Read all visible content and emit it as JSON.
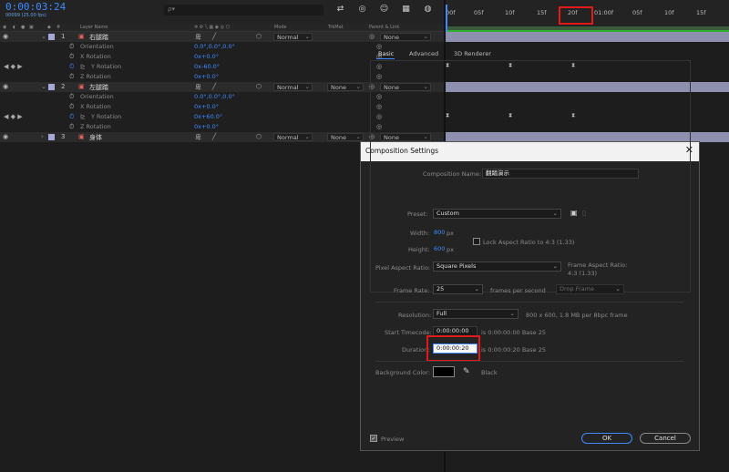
{
  "timeline": {
    "timecode": "0:00:03:24",
    "fps": "00099 (25.00 fps)",
    "search_placeholder": "ρ▾",
    "columns": {
      "layer_name": "Layer Name",
      "mode": "Mode",
      "trkmat": "TrkMat",
      "parent": "Parent & Link"
    },
    "ruler_ticks": [
      "00f",
      "05f",
      "10f",
      "15f",
      "20f",
      "01:00f",
      "05f",
      "10f",
      "15f"
    ],
    "layers": [
      {
        "num": "1",
        "name": "右腿踏",
        "mode": "Normal",
        "trkmat": "",
        "parent": "None",
        "props": [
          {
            "name": "Orientation",
            "value": "0.0°,0.0°,0.0°"
          },
          {
            "name": "X Rotation",
            "value": "0x+0.0°"
          },
          {
            "name": "Y Rotation",
            "value": "0x-60.0°"
          },
          {
            "name": "Z Rotation",
            "value": "0x+0.0°"
          }
        ]
      },
      {
        "num": "2",
        "name": "左腿踏",
        "mode": "Normal",
        "trkmat": "None",
        "parent": "None",
        "props": [
          {
            "name": "Orientation",
            "value": "0.0°,0.0°,0.0°"
          },
          {
            "name": "X Rotation",
            "value": "0x+0.0°"
          },
          {
            "name": "Y Rotation",
            "value": "0x+60.0°"
          },
          {
            "name": "Z Rotation",
            "value": "0x+0.0°"
          }
        ]
      },
      {
        "num": "3",
        "name": "身体",
        "mode": "Normal",
        "trkmat": "None",
        "parent": "None",
        "props": []
      }
    ]
  },
  "dialog": {
    "title": "Composition Settings",
    "close": "✕",
    "comp_name_label": "Composition Name:",
    "comp_name_value": "翻踏演示",
    "tabs": [
      "Basic",
      "Advanced",
      "3D Renderer"
    ],
    "preset_label": "Preset:",
    "preset_value": "Custom",
    "width_label": "Width:",
    "width_value": "800",
    "width_unit": "px",
    "height_label": "Height:",
    "height_value": "600",
    "height_unit": "px",
    "lock_label": "Lock Aspect Ratio to 4:3 (1.33)",
    "par_label": "Pixel Aspect Ratio:",
    "par_value": "Square Pixels",
    "frame_aspect_label": "Frame Aspect Ratio:",
    "frame_aspect_value": "4:3 (1.33)",
    "frame_rate_label": "Frame Rate:",
    "frame_rate_value": "25",
    "fps_text": "frames per second",
    "drop_frame": "Drop Frame",
    "resolution_label": "Resolution:",
    "resolution_value": "Full",
    "resolution_info": "800 x 600, 1.8 MB per 8bpc frame",
    "start_tc_label": "Start Timecode:",
    "start_tc_value": "0:00:00:00",
    "start_tc_info": "is 0:00:00:00  Base 25",
    "duration_label": "Duration:",
    "duration_value": "0:00:00:20",
    "duration_info": "is 0:00:00:20  Base 25",
    "bg_color_label": "Background Color:",
    "bg_color_name": "Black",
    "preview_label": "Preview",
    "ok": "OK",
    "cancel": "Cancel"
  },
  "colors": {
    "accent": "#3d8cff",
    "highlight": "#e21a1a",
    "label": "#a8a8d8"
  }
}
